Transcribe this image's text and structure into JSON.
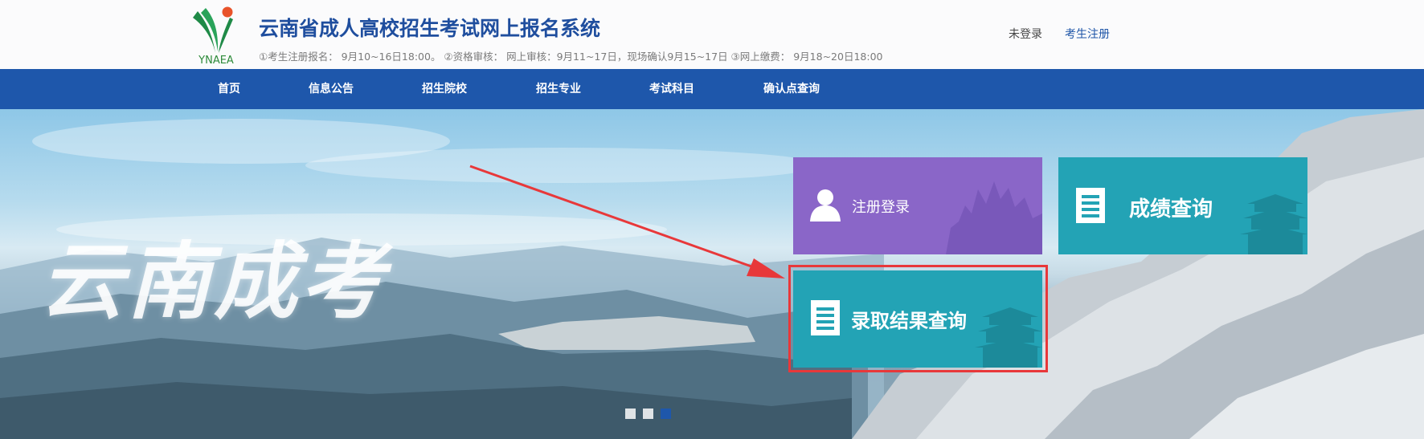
{
  "header": {
    "logo_text": "YNAEA",
    "site_title": "云南省成人高校招生考试网上报名系统",
    "schedule": "①考生注册报名： 9月10~16日18:00。 ②资格审核： 网上审核：9月11~17日，现场确认9月15~17日 ③网上缴费： 9月18~20日18:00",
    "login_status": "未登录",
    "register_link": "考生注册"
  },
  "nav": {
    "items": [
      {
        "label": "首页"
      },
      {
        "label": "信息公告"
      },
      {
        "label": "招生院校"
      },
      {
        "label": "招生专业"
      },
      {
        "label": "考试科目"
      },
      {
        "label": "确认点查询"
      }
    ]
  },
  "banner": {
    "calligraphy_text": "云南成考",
    "tiles": {
      "register": {
        "label": "注册登录",
        "icon": "user-icon"
      },
      "score": {
        "label": "成绩查询",
        "icon": "document-icon"
      },
      "admission": {
        "label": "录取结果查询",
        "icon": "document-icon"
      }
    },
    "carousel": {
      "count": 3,
      "active_index": 2
    }
  },
  "colors": {
    "brand_blue": "#1e57ab",
    "title_blue": "#1f4e9e",
    "tile_purple": "#8a66c8",
    "tile_teal": "#23a3b5",
    "annotation_red": "#e8383a"
  }
}
